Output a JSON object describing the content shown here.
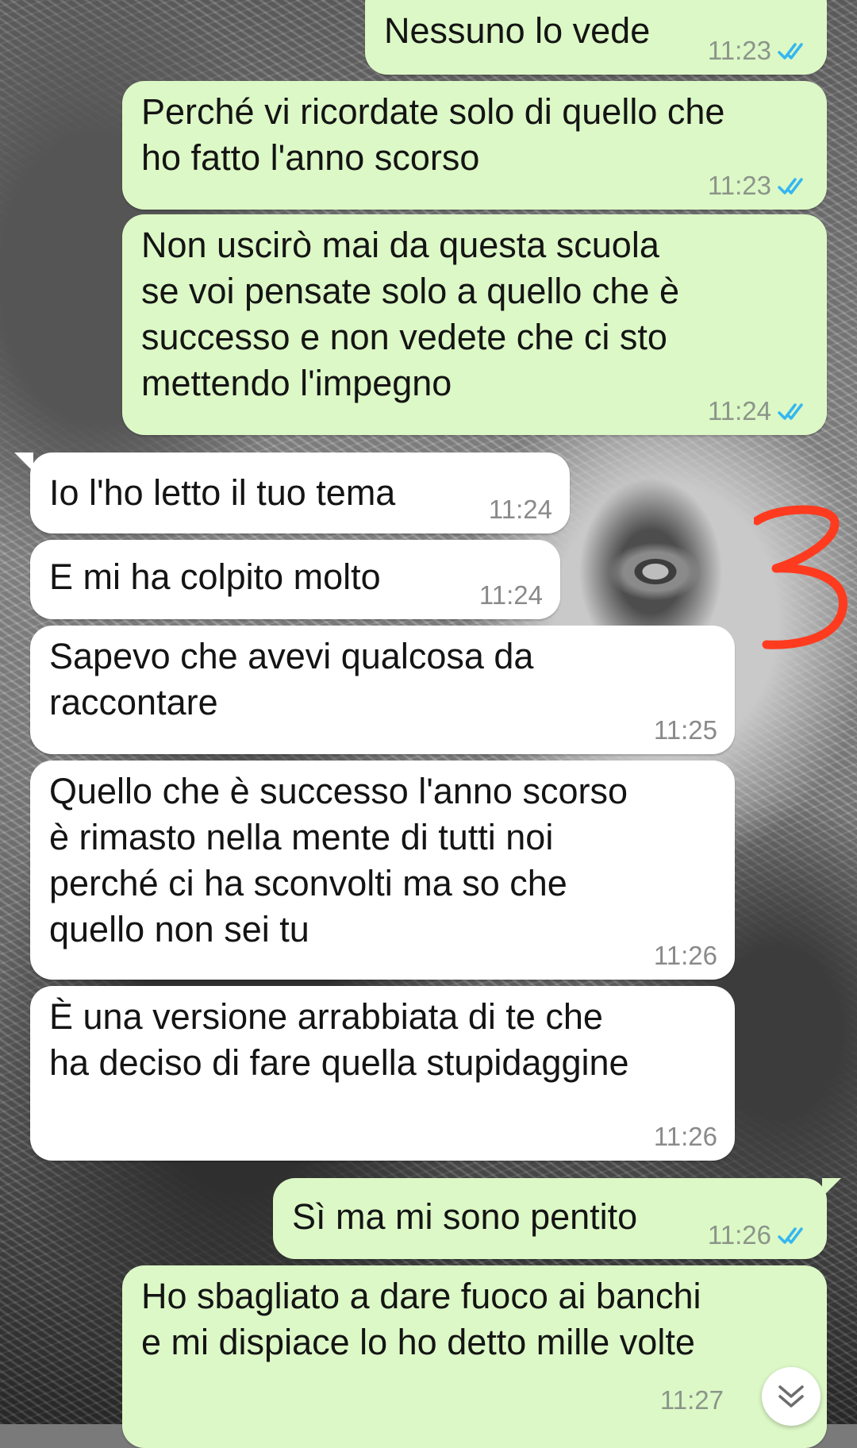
{
  "messages": [
    {
      "direction": "out",
      "text": "Nessuno lo vede",
      "time": "11:23",
      "status": "read"
    },
    {
      "direction": "out",
      "text": "Perché vi ricordate solo di quello che\nho fatto l'anno scorso",
      "time": "11:23",
      "status": "read"
    },
    {
      "direction": "out",
      "text": "Non uscirò mai da questa scuola\nse voi pensate solo a quello che è\nsuccesso e non vedete che ci sto\nmettendo l'impegno",
      "time": "11:24",
      "status": "read"
    },
    {
      "direction": "in",
      "text": "Io l'ho letto il tuo tema",
      "time": "11:24"
    },
    {
      "direction": "in",
      "text": "E mi ha colpito molto",
      "time": "11:24"
    },
    {
      "direction": "in",
      "text": "Sapevo che avevi qualcosa da\nraccontare",
      "time": "11:25"
    },
    {
      "direction": "in",
      "text": "Quello che è successo l'anno scorso\nè rimasto nella mente di tutti noi\nperché ci ha sconvolti ma so che\nquello non sei tu",
      "time": "11:26"
    },
    {
      "direction": "in",
      "text": "È una versione arrabbiata di te che\nha deciso di fare quella stupidaggine",
      "time": "11:26"
    },
    {
      "direction": "out",
      "text": "Sì ma mi sono pentito",
      "time": "11:26",
      "status": "read"
    },
    {
      "direction": "out",
      "text": "Ho sbagliato a dare fuoco ai banchi\ne mi dispiace lo ho detto mille volte",
      "time": "11:27",
      "status": "read"
    }
  ],
  "annotation": {
    "text": "3",
    "color": "#ff3b1f"
  },
  "colors": {
    "outgoing_bubble": "#dcf8c6",
    "incoming_bubble": "#ffffff",
    "read_ticks": "#34b7f1"
  },
  "icons": {
    "read_receipt": "double-check-icon",
    "scroll": "chevron-double-down-icon"
  }
}
